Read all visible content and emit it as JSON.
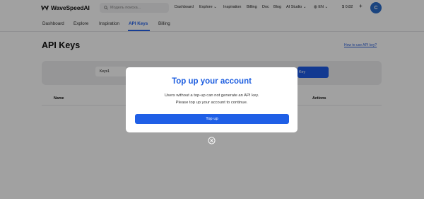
{
  "brand": {
    "name": "WaveSpeedAI"
  },
  "search": {
    "placeholder": "Модель поиска..."
  },
  "topnav": {
    "dashboard": "Dashboard",
    "explore": "Explore",
    "inspiration": "Inspiration",
    "billing": "Billing",
    "doc": "Doc",
    "blog": "Blog",
    "ai_studio": "AI Studio",
    "language": "EN",
    "balance": "$ 0.82",
    "plus": "+",
    "avatar_initial": "C"
  },
  "subnav": {
    "tabs": [
      "Dashboard",
      "Explore",
      "Inspiration",
      "API Keys",
      "Billing"
    ],
    "active": "API Keys"
  },
  "page": {
    "title": "API Keys",
    "howto_link": "How to use API key?"
  },
  "form": {
    "name_value": "Keys1",
    "create_button": "Key"
  },
  "table": {
    "headers": {
      "name": "Name",
      "actions": "Actions"
    }
  },
  "modal": {
    "title": "Top up your account",
    "line1": "Users without a top-up can not generate an API key.",
    "line2": "Please top up your account to continue.",
    "button": "Top up"
  },
  "colors": {
    "accent": "#1f5fe6",
    "overlay": "rgba(0,0,0,0.37)"
  },
  "icons": {
    "logo": "wave-logo-icon",
    "search": "search-icon",
    "close": "close-circle-icon"
  }
}
